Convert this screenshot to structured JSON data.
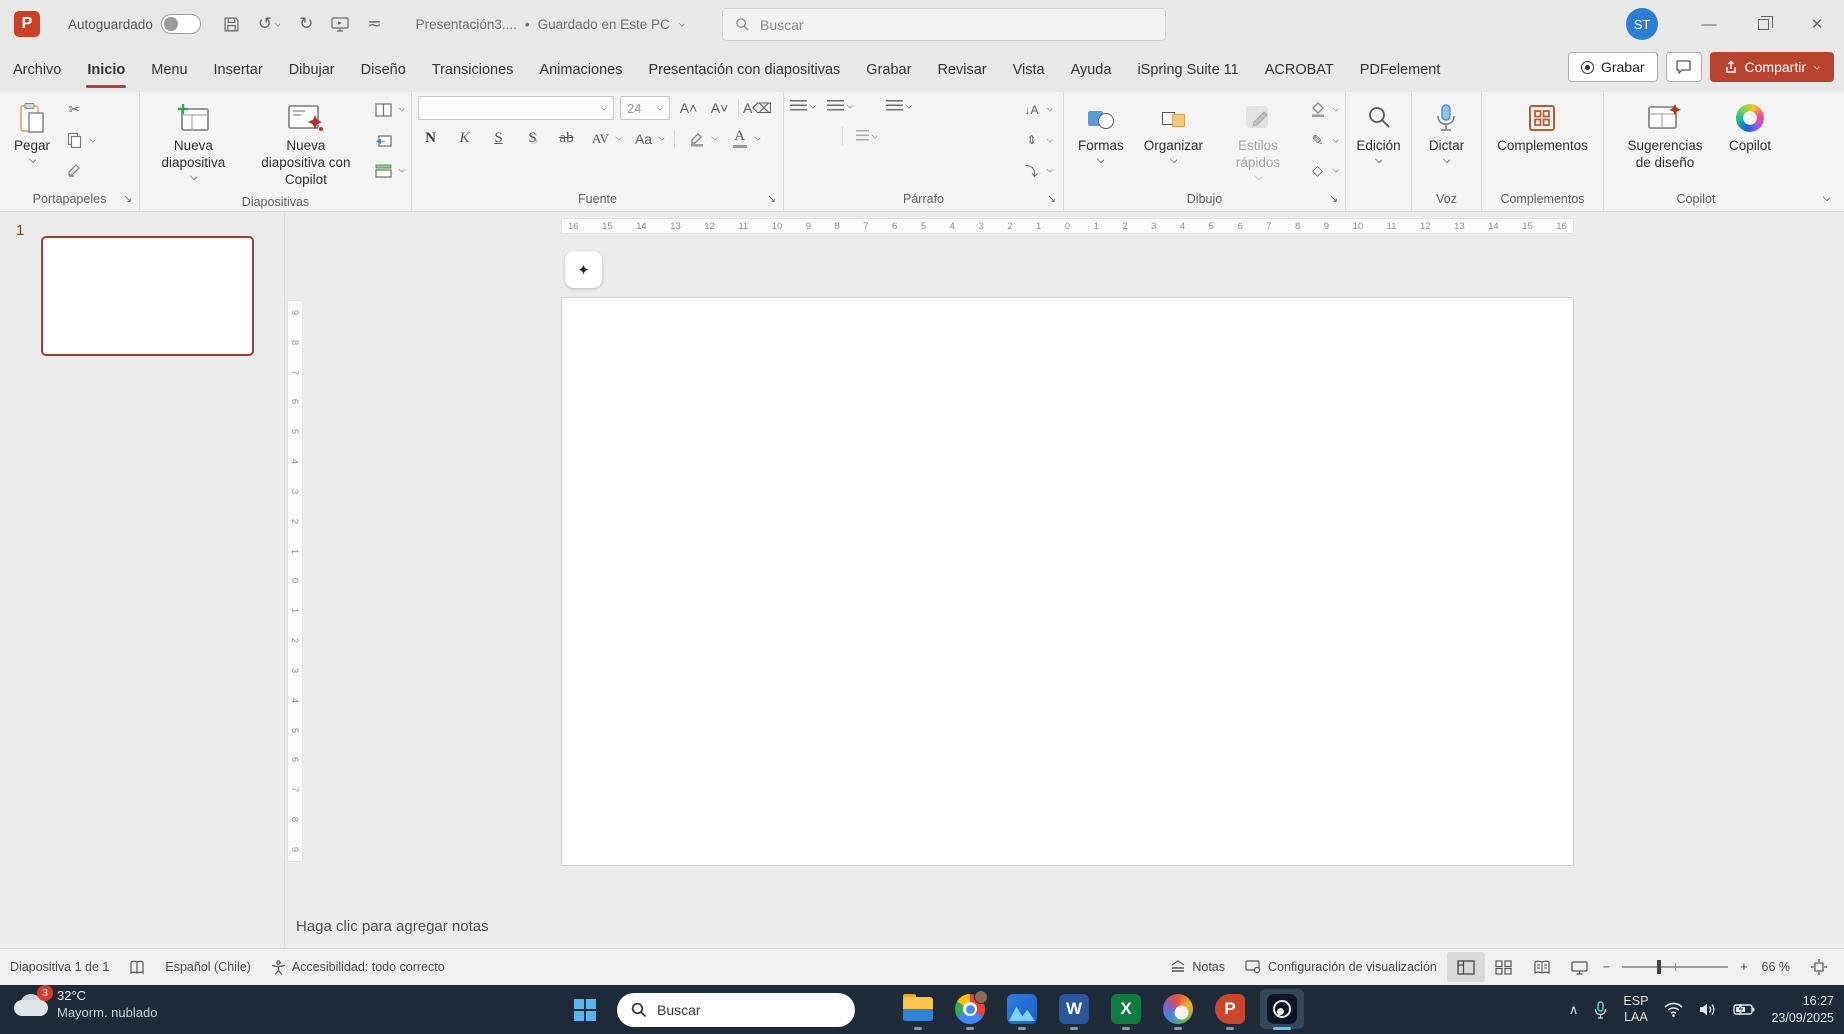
{
  "title_bar": {
    "app_initial": "P",
    "autosave_label": "Autoguardado",
    "save_status_sep": "•",
    "doc_title": "Presentación3....",
    "save_status": "Guardado en Este PC",
    "search_placeholder": "Buscar",
    "avatar_initials": "ST",
    "undo_glyph": "↺",
    "redo_glyph": "↻",
    "customize_glyph": "≂",
    "close_glyph": "✕",
    "minimize_glyph": "—"
  },
  "tabs": [
    {
      "label": "Archivo"
    },
    {
      "label": "Inicio",
      "active": true
    },
    {
      "label": "Menu"
    },
    {
      "label": "Insertar"
    },
    {
      "label": "Dibujar"
    },
    {
      "label": "Diseño"
    },
    {
      "label": "Transiciones"
    },
    {
      "label": "Animaciones"
    },
    {
      "label": "Presentación con diapositivas"
    },
    {
      "label": "Grabar"
    },
    {
      "label": "Revisar"
    },
    {
      "label": "Vista"
    },
    {
      "label": "Ayuda"
    },
    {
      "label": "iSpring Suite 11"
    },
    {
      "label": "ACROBAT"
    },
    {
      "label": "PDFelement"
    }
  ],
  "tab_actions": {
    "record": "Grabar",
    "share": "Compartir"
  },
  "ribbon": {
    "clipboard": {
      "paste": "Pegar",
      "cut_glyph": "✂",
      "group": "Portapapeles",
      "launcher": "↘"
    },
    "slides": {
      "new_slide": "Nueva diapositiva",
      "new_slide_copilot": "Nueva diapositiva con Copilot",
      "group": "Diapositivas"
    },
    "font": {
      "size": "24",
      "grow": "A˄",
      "shrink": "A˅",
      "clear": "A⌫",
      "bold": "N",
      "italic": "K",
      "underline": "S",
      "shadow": "S",
      "strike": "ab",
      "spacing": "AV",
      "case": "Aa",
      "color": "A",
      "group": "Fuente",
      "launcher": "↘"
    },
    "paragraph": {
      "group": "Párrafo",
      "launcher": "↘",
      "dir_glyph": "↓A",
      "valign_glyph": "⇕",
      "smartart_glyph": "⤵"
    },
    "drawing": {
      "shapes": "Formas",
      "arrange": "Organizar",
      "quick_styles": "Estilos rápidos",
      "outline_glyph": "✎",
      "effects_glyph": "◇",
      "group": "Dibujo",
      "launcher": "↘"
    },
    "editing": {
      "label": "Edición"
    },
    "voice": {
      "dictate": "Dictar",
      "group": "Voz"
    },
    "addins": {
      "label": "Complementos",
      "group": "Complementos"
    },
    "copilot": {
      "design": "Sugerencias de diseño",
      "copilot": "Copilot",
      "group": "Copilot"
    },
    "fab_glyph": "✦"
  },
  "slide_panel": {
    "slide_number": "1"
  },
  "rulers": {
    "horizontal": [
      "16",
      "15",
      "14",
      "13",
      "12",
      "11",
      "10",
      "9",
      "8",
      "7",
      "6",
      "5",
      "4",
      "3",
      "2",
      "1",
      "0",
      "1",
      "2",
      "3",
      "4",
      "5",
      "6",
      "7",
      "8",
      "9",
      "10",
      "11",
      "12",
      "13",
      "14",
      "15",
      "16"
    ],
    "vertical": [
      "9",
      "8",
      "7",
      "6",
      "5",
      "4",
      "3",
      "2",
      "1",
      "0",
      "1",
      "2",
      "3",
      "4",
      "5",
      "6",
      "7",
      "8",
      "9"
    ]
  },
  "notes": {
    "placeholder": "Haga clic para agregar notas"
  },
  "status_bar": {
    "slide_indicator": "Diapositiva 1 de 1",
    "language": "Español (Chile)",
    "accessibility": "Accesibilidad: todo correcto",
    "notes": "Notas",
    "display_settings": "Configuración de visualización",
    "zoom_out": "−",
    "zoom_in": "+",
    "zoom": "66 %"
  },
  "taskbar": {
    "weather": {
      "badge": "3",
      "temp": "32°C",
      "condition": "Mayorm. nublado"
    },
    "search_placeholder": "Buscar",
    "apps": {
      "word": "W",
      "excel": "X",
      "powerpoint": "P"
    },
    "tray": {
      "lang_top": "ESP",
      "lang_bottom": "LAA",
      "time": "16:27",
      "date": "23/09/2025",
      "chevron": "∧"
    }
  },
  "colors": {
    "accent_red": "#ae4431",
    "share_red": "#b8432f",
    "avatar_blue": "#2b7cd3",
    "taskbar_bg": "#1e2a38"
  }
}
